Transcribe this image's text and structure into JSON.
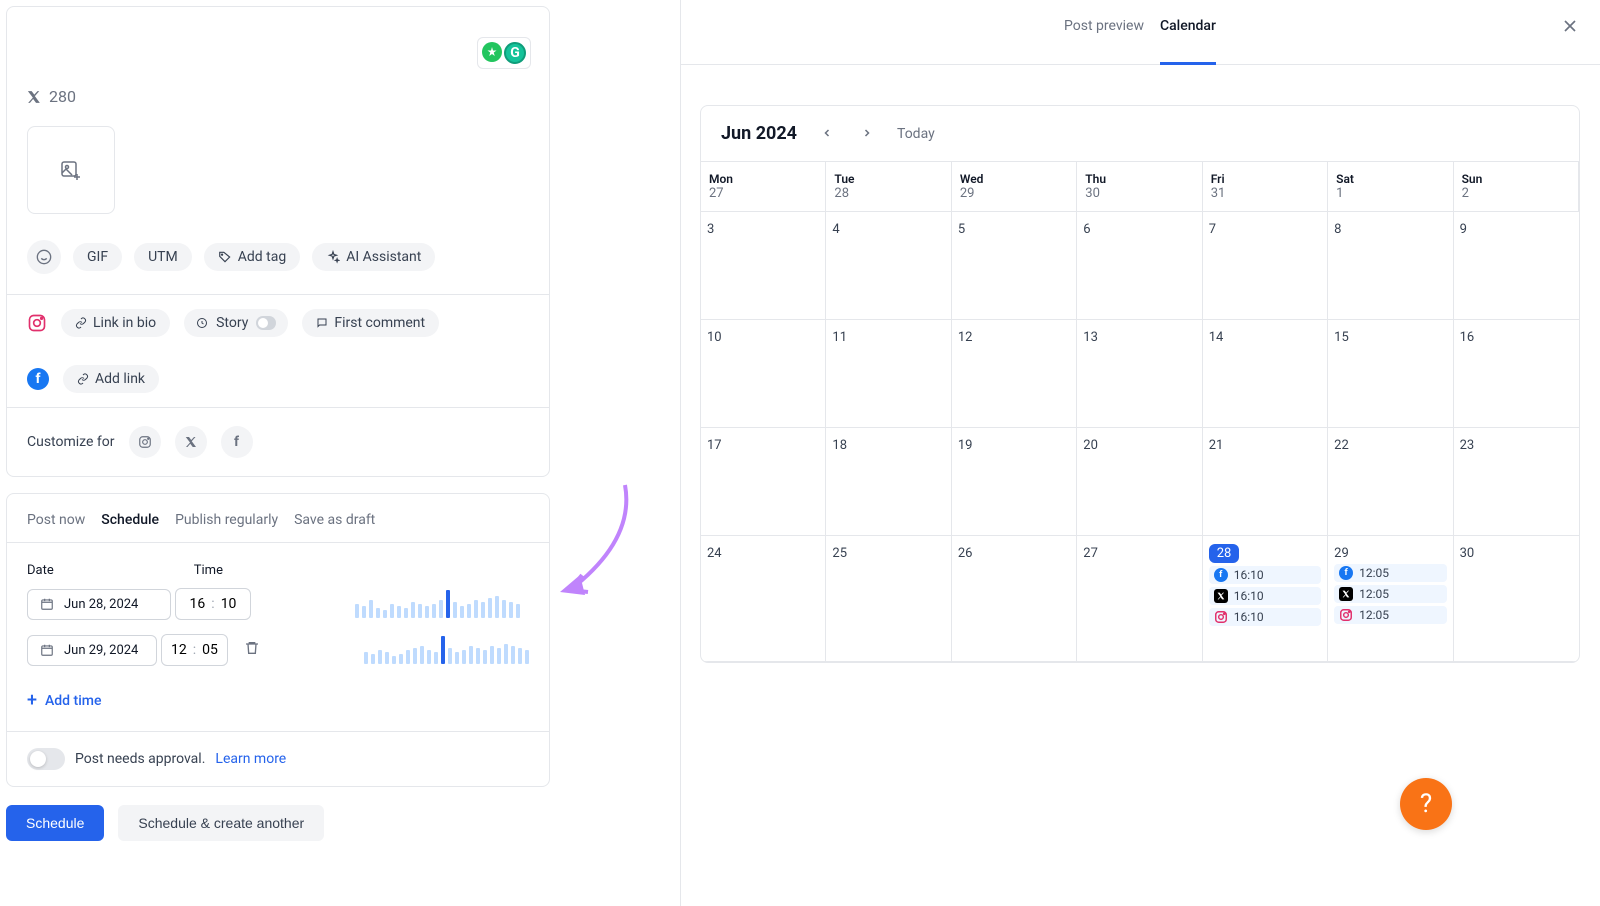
{
  "compose": {
    "char_count": "280",
    "actions": {
      "gif": "GIF",
      "utm": "UTM",
      "add_tag": "Add tag",
      "ai_assistant": "AI Assistant"
    },
    "instagram": {
      "link_in_bio": "Link in bio",
      "story": "Story",
      "first_comment": "First comment"
    },
    "facebook": {
      "add_link": "Add link"
    },
    "customize_for": "Customize for"
  },
  "schedule": {
    "tabs": {
      "post_now": "Post now",
      "schedule": "Schedule",
      "publish_regularly": "Publish regularly",
      "save_as_draft": "Save as draft"
    },
    "labels": {
      "date": "Date",
      "time": "Time"
    },
    "rows": [
      {
        "date": "Jun 28, 2024",
        "hour": "16",
        "min": "10"
      },
      {
        "date": "Jun 29, 2024",
        "hour": "12",
        "min": "05"
      }
    ],
    "add_time": "Add time",
    "approval": {
      "text": "Post needs approval.",
      "learn_more": "Learn more"
    }
  },
  "buttons": {
    "schedule": "Schedule",
    "schedule_another": "Schedule & create another"
  },
  "right": {
    "tabs": {
      "post_preview": "Post preview",
      "calendar": "Calendar"
    }
  },
  "calendar": {
    "month": "Jun 2024",
    "today": "Today",
    "day_headers": [
      {
        "name": "Mon",
        "num": "27"
      },
      {
        "name": "Tue",
        "num": "28"
      },
      {
        "name": "Wed",
        "num": "29"
      },
      {
        "name": "Thu",
        "num": "30"
      },
      {
        "name": "Fri",
        "num": "31"
      },
      {
        "name": "Sat",
        "num": "1"
      },
      {
        "name": "Sun",
        "num": "2"
      }
    ],
    "weeks": [
      [
        "3",
        "4",
        "5",
        "6",
        "7",
        "8",
        "9"
      ],
      [
        "10",
        "11",
        "12",
        "13",
        "14",
        "15",
        "16"
      ],
      [
        "17",
        "18",
        "19",
        "20",
        "21",
        "22",
        "23"
      ],
      [
        "24",
        "25",
        "26",
        "27",
        "28",
        "29",
        "30"
      ]
    ],
    "events": {
      "28": [
        {
          "network": "fb",
          "time": "16:10"
        },
        {
          "network": "x",
          "time": "16:10"
        },
        {
          "network": "ig",
          "time": "16:10"
        }
      ],
      "29": [
        {
          "network": "fb",
          "time": "12:05"
        },
        {
          "network": "x",
          "time": "12:05"
        },
        {
          "network": "ig",
          "time": "12:05"
        }
      ]
    },
    "selected_day": "28"
  }
}
